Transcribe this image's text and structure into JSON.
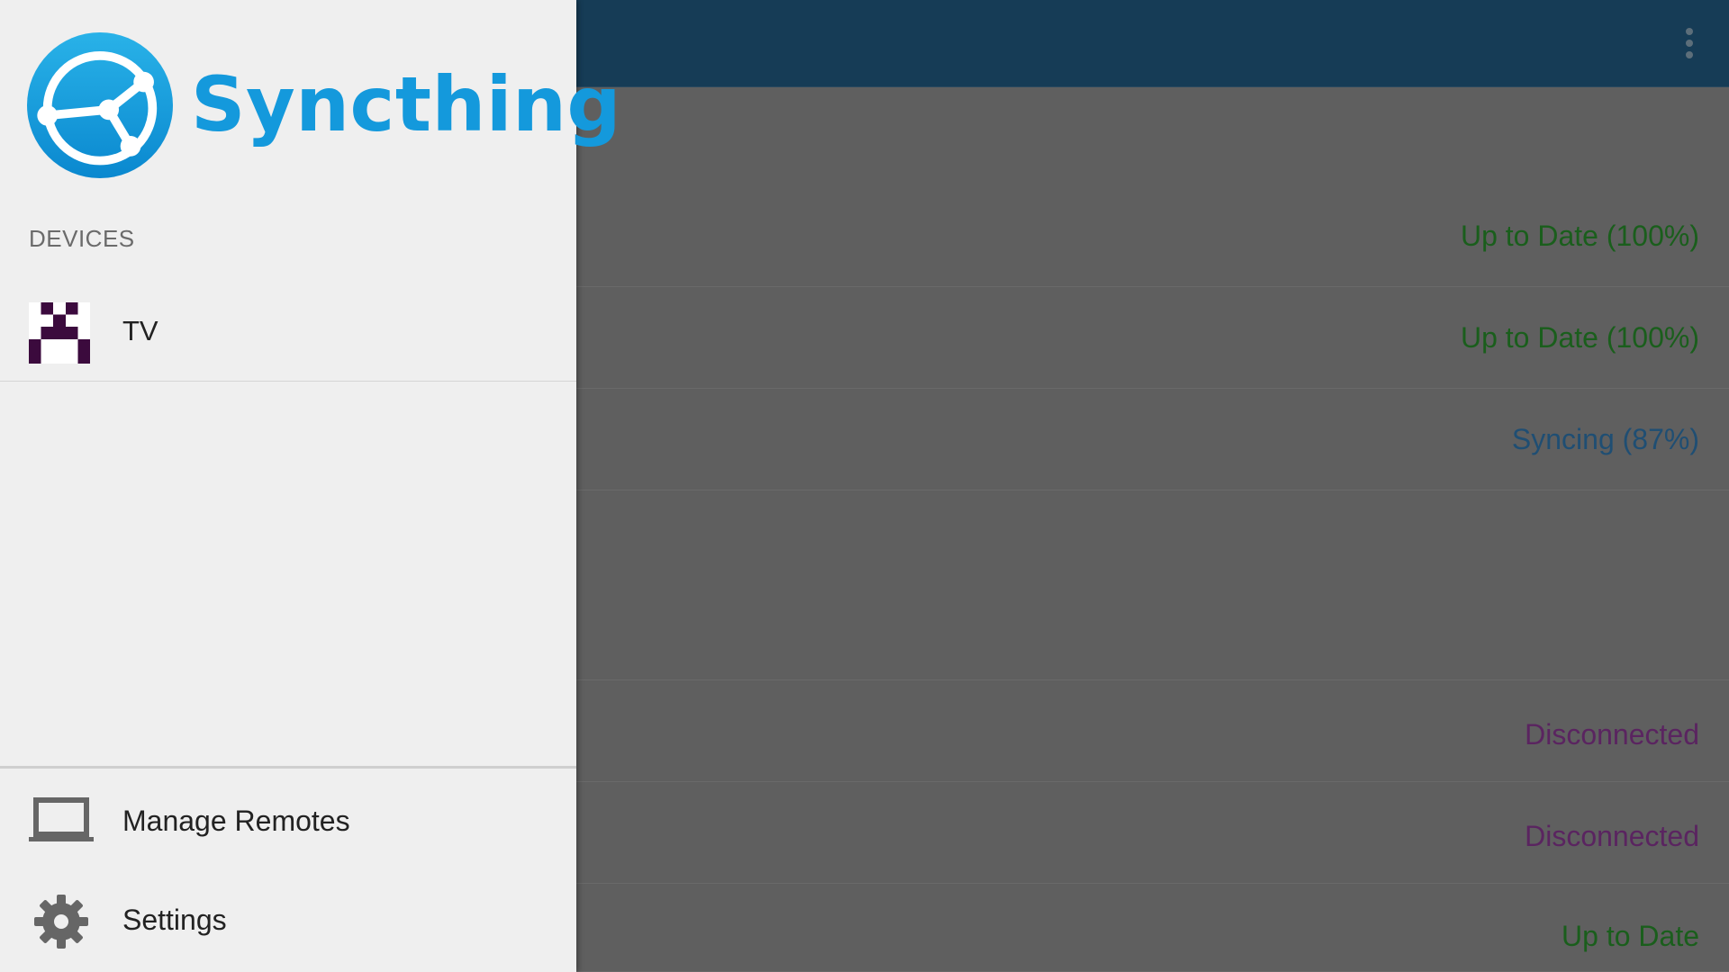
{
  "app": {
    "title": "Syncthing",
    "brand_color": "#1499dc",
    "toolbar_color": "#163c56"
  },
  "toolbar": {
    "overflow_icon": "more-vert-icon"
  },
  "list": {
    "rows": [
      {
        "status": "Up to Date (100%)",
        "color": "green"
      },
      {
        "status": "Up to Date (100%)",
        "color": "green"
      },
      {
        "status": "Syncing (87%)",
        "color": "blue"
      },
      {
        "status": "",
        "color": "none"
      },
      {
        "status": "Disconnected",
        "color": "purple"
      },
      {
        "status": "Disconnected",
        "color": "purple"
      },
      {
        "status": "Up to Date",
        "color": "green"
      }
    ]
  },
  "drawer": {
    "devices_header": "DEVICES",
    "devices": [
      {
        "label": "TV",
        "icon": "identicon"
      }
    ],
    "items": [
      {
        "label": "Manage Remotes",
        "icon": "laptop-icon"
      },
      {
        "label": "Settings",
        "icon": "gear-icon"
      }
    ]
  }
}
